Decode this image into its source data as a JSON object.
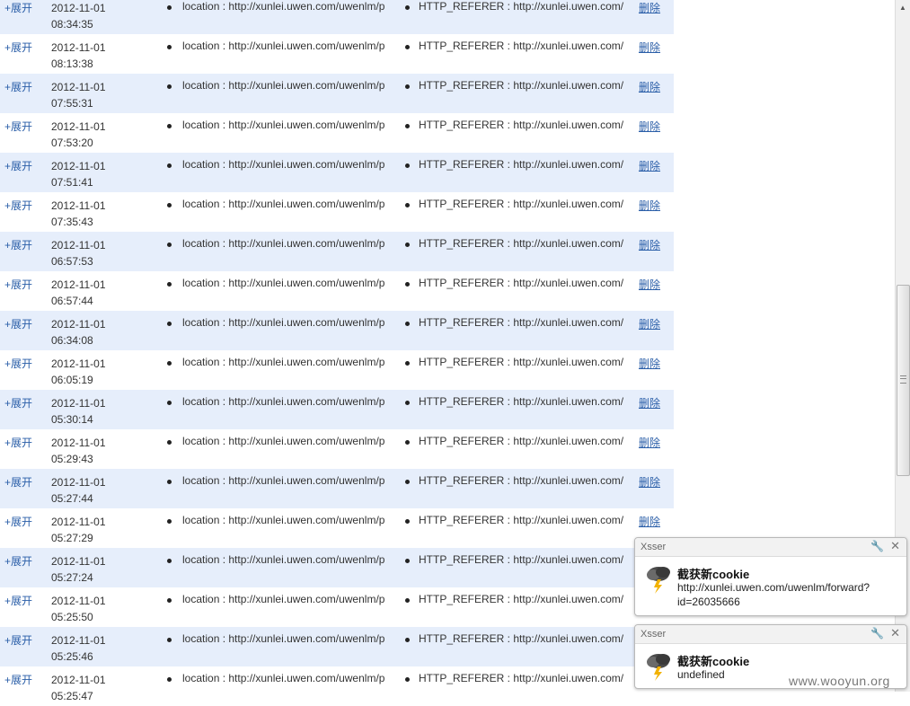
{
  "row_labels": {
    "expand": "+展开",
    "location_prefix": "location : http://xunlei.uwen.com/uwenlm/p",
    "referer_prefix": "HTTP_REFERER : http://xunlei.uwen.com/",
    "delete": "删除"
  },
  "rows": [
    {
      "date": "2012-11-01",
      "time": "08:34:35"
    },
    {
      "date": "2012-11-01",
      "time": "08:13:38"
    },
    {
      "date": "2012-11-01",
      "time": "07:55:31"
    },
    {
      "date": "2012-11-01",
      "time": "07:53:20"
    },
    {
      "date": "2012-11-01",
      "time": "07:51:41"
    },
    {
      "date": "2012-11-01",
      "time": "07:35:43"
    },
    {
      "date": "2012-11-01",
      "time": "06:57:53"
    },
    {
      "date": "2012-11-01",
      "time": "06:57:44"
    },
    {
      "date": "2012-11-01",
      "time": "06:34:08"
    },
    {
      "date": "2012-11-01",
      "time": "06:05:19"
    },
    {
      "date": "2012-11-01",
      "time": "05:30:14"
    },
    {
      "date": "2012-11-01",
      "time": "05:29:43"
    },
    {
      "date": "2012-11-01",
      "time": "05:27:44"
    },
    {
      "date": "2012-11-01",
      "time": "05:27:29"
    },
    {
      "date": "2012-11-01",
      "time": "05:27:24"
    },
    {
      "date": "2012-11-01",
      "time": "05:25:50"
    },
    {
      "date": "2012-11-01",
      "time": "05:25:46"
    },
    {
      "date": "2012-11-01",
      "time": "05:25:47"
    }
  ],
  "notifications": [
    {
      "source": "Xsser",
      "title": "截获新cookie",
      "body": "http://xunlei.uwen.com/uwenlm/forward?id=26035666"
    },
    {
      "source": "Xsser",
      "title": "截获新cookie",
      "body": "undefined"
    }
  ],
  "watermark": "www.wooyun.org",
  "colors": {
    "row_alt_bg": "#e6eefb",
    "link": "#2a5ea8"
  },
  "icons": {
    "notification": "storm-cloud-icon",
    "settings": "wrench-icon",
    "close": "close-icon"
  }
}
